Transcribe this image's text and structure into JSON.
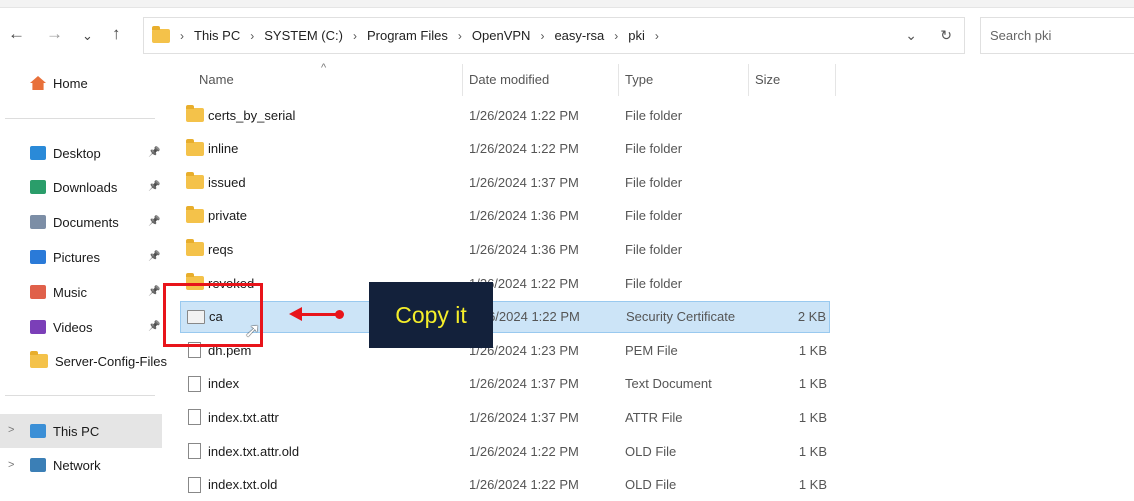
{
  "nav": {
    "back": "←",
    "forward": "→",
    "recent": "⌄",
    "up": "↑"
  },
  "breadcrumb": [
    "This PC",
    "SYSTEM (C:)",
    "Program Files",
    "OpenVPN",
    "easy-rsa",
    "pki"
  ],
  "address_dropdown": "⌄",
  "refresh": "↻",
  "search": {
    "placeholder": "Search pki"
  },
  "sidebar": {
    "home": "Home",
    "pinned": [
      {
        "label": "Desktop",
        "color": "#2a8ad8"
      },
      {
        "label": "Downloads",
        "color": "#2a9d6a"
      },
      {
        "label": "Documents",
        "color": "#7c8ea6"
      },
      {
        "label": "Pictures",
        "color": "#2a7ad8"
      },
      {
        "label": "Music",
        "color": "#e0604a"
      },
      {
        "label": "Videos",
        "color": "#7b3fb8"
      }
    ],
    "extra": "Server-Config-Files",
    "this_pc": "This PC",
    "network": "Network"
  },
  "columns": {
    "name": "Name",
    "date": "Date modified",
    "type": "Type",
    "size": "Size"
  },
  "files": [
    {
      "name": "certs_by_serial",
      "date": "1/26/2024 1:22 PM",
      "type": "File folder",
      "size": "",
      "icon": "folder"
    },
    {
      "name": "inline",
      "date": "1/26/2024 1:22 PM",
      "type": "File folder",
      "size": "",
      "icon": "folder"
    },
    {
      "name": "issued",
      "date": "1/26/2024 1:37 PM",
      "type": "File folder",
      "size": "",
      "icon": "folder"
    },
    {
      "name": "private",
      "date": "1/26/2024 1:36 PM",
      "type": "File folder",
      "size": "",
      "icon": "folder"
    },
    {
      "name": "reqs",
      "date": "1/26/2024 1:36 PM",
      "type": "File folder",
      "size": "",
      "icon": "folder"
    },
    {
      "name": "revoked",
      "date": "1/26/2024 1:22 PM",
      "type": "File folder",
      "size": "",
      "icon": "folder"
    },
    {
      "name": "ca",
      "date": "1/26/2024 1:22 PM",
      "type": "Security Certificate",
      "size": "2 KB",
      "icon": "certificate",
      "selected": true
    },
    {
      "name": "dh.pem",
      "date": "1/26/2024 1:23 PM",
      "type": "PEM File",
      "size": "1 KB",
      "icon": "file"
    },
    {
      "name": "index",
      "date": "1/26/2024 1:37 PM",
      "type": "Text Document",
      "size": "1 KB",
      "icon": "text"
    },
    {
      "name": "index.txt.attr",
      "date": "1/26/2024 1:37 PM",
      "type": "ATTR File",
      "size": "1 KB",
      "icon": "text"
    },
    {
      "name": "index.txt.attr.old",
      "date": "1/26/2024 1:22 PM",
      "type": "OLD File",
      "size": "1 KB",
      "icon": "text"
    },
    {
      "name": "index.txt.old",
      "date": "1/26/2024 1:22 PM",
      "type": "OLD File",
      "size": "1 KB",
      "icon": "text"
    }
  ],
  "annotation": {
    "label": "Copy it",
    "color": "#e8141a"
  }
}
